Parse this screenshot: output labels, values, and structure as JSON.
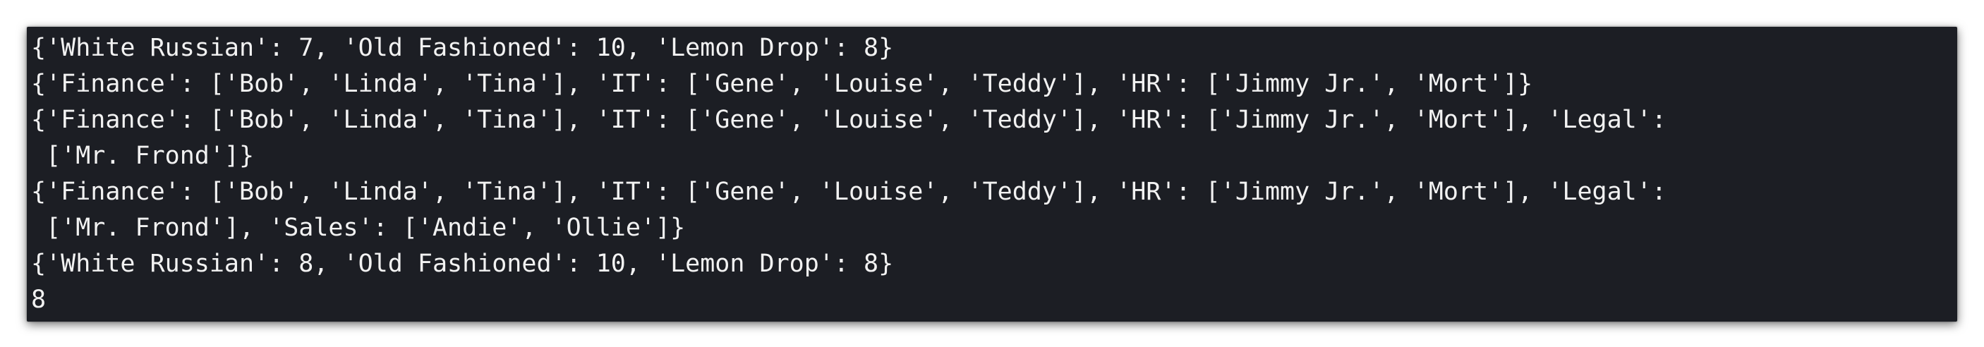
{
  "terminal": {
    "lines": [
      "{'White Russian': 7, 'Old Fashioned': 10, 'Lemon Drop': 8}",
      "{'Finance': ['Bob', 'Linda', 'Tina'], 'IT': ['Gene', 'Louise', 'Teddy'], 'HR': ['Jimmy Jr.', 'Mort']}",
      "{'Finance': ['Bob', 'Linda', 'Tina'], 'IT': ['Gene', 'Louise', 'Teddy'], 'HR': ['Jimmy Jr.', 'Mort'], 'Legal':",
      " ['Mr. Frond']}",
      "{'Finance': ['Bob', 'Linda', 'Tina'], 'IT': ['Gene', 'Louise', 'Teddy'], 'HR': ['Jimmy Jr.', 'Mort'], 'Legal':",
      " ['Mr. Frond'], 'Sales': ['Andie', 'Ollie']}",
      "{'White Russian': 8, 'Old Fashioned': 10, 'Lemon Drop': 8}",
      "8"
    ]
  },
  "colors": {
    "background": "#1c1e24",
    "text": "#f2f2f2"
  }
}
